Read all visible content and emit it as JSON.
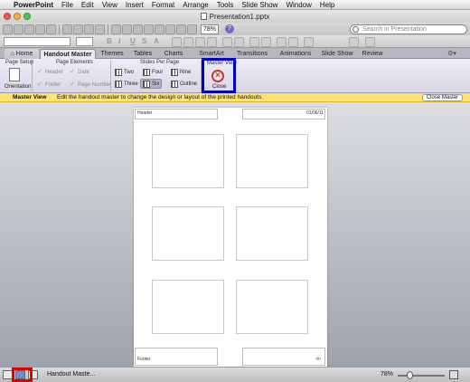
{
  "menubar": {
    "apple": "",
    "app": "PowerPoint",
    "items": [
      "File",
      "Edit",
      "View",
      "Insert",
      "Format",
      "Arrange",
      "Tools",
      "Slide Show",
      "Window",
      "Help"
    ]
  },
  "window": {
    "title": "Presentation1.pptx"
  },
  "toolbar": {
    "zoom": "78%",
    "help": "?",
    "search_placeholder": "Search in Presentation"
  },
  "tabs": {
    "home": "Home",
    "handout_master": "Handout Master",
    "themes": "Themes",
    "tables": "Tables",
    "charts": "Charts",
    "smartart": "SmartArt",
    "transitions": "Transitions",
    "animations": "Animations",
    "slide_show": "Slide Show",
    "review": "Review"
  },
  "ribbon": {
    "page_setup": {
      "title": "Page Setup",
      "orientation": "Orientation"
    },
    "page_elements": {
      "title": "Page Elements",
      "header": "Header",
      "date": "Date",
      "footer": "Footer",
      "page_number": "Page Number"
    },
    "slides_per_page": {
      "title": "Slides Per Page",
      "two": "Two",
      "four": "Four",
      "nine": "Nine",
      "three": "Three",
      "six": "Six",
      "outline": "Outline"
    },
    "master_view": {
      "title": "Master View",
      "close": "Close"
    }
  },
  "message_bar": {
    "label": "Master View",
    "text": "Edit the handout master to change the design or layout of the printed handouts.",
    "button": "Close Master"
  },
  "page": {
    "header": "Header",
    "date": "01/06/11",
    "footer": "Footer",
    "page_number": "‹#›"
  },
  "statusbar": {
    "text": "Handout Maste...",
    "zoom": "78%",
    "zoom_level": 0.25
  },
  "colors": {
    "highlight": "#0000c8",
    "view_highlight": "#e00000",
    "message_bar": "#ffe36e"
  }
}
